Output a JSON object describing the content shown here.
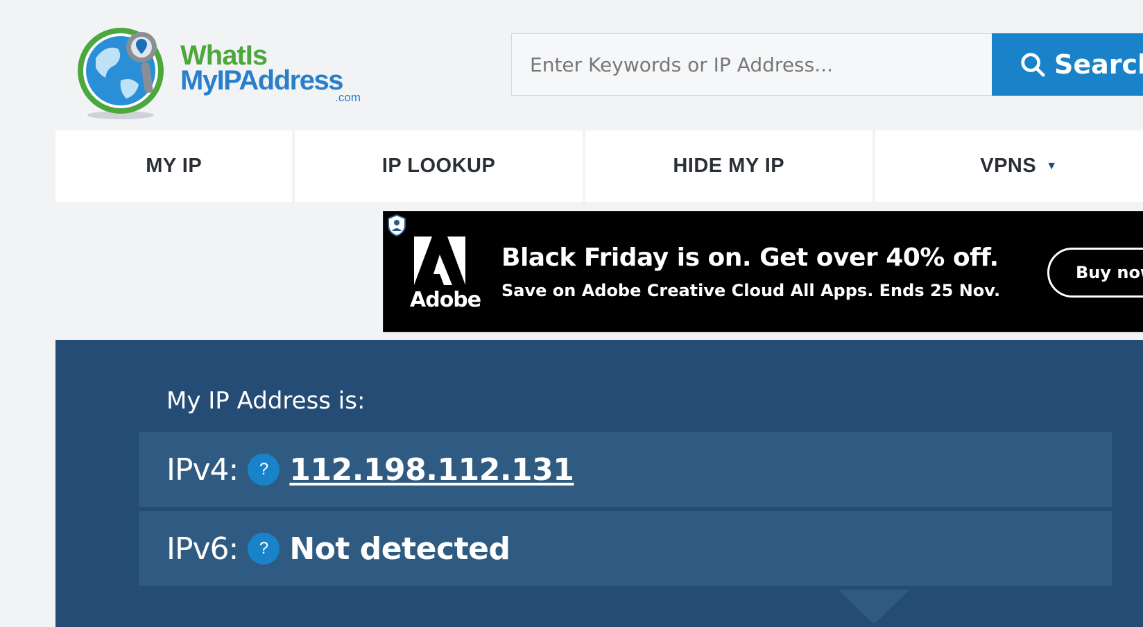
{
  "brand": {
    "line1": "WhatIs",
    "line2": "MyIPAddress",
    "suffix": ".com"
  },
  "search": {
    "placeholder": "Enter Keywords or IP Address...",
    "button_label": "Search",
    "button_icon": "search-icon"
  },
  "nav": {
    "items": [
      {
        "label": "MY IP"
      },
      {
        "label": "IP LOOKUP"
      },
      {
        "label": "HIDE MY IP"
      },
      {
        "label": "VPNS",
        "icon": "caret-down-icon"
      }
    ]
  },
  "ad": {
    "brand": "Adobe",
    "headline": "Black Friday is on. Get over 40% off.",
    "subline": "Save on Adobe Creative Cloud All Apps. Ends 25 Nov.",
    "cta": "Buy now"
  },
  "ip": {
    "heading": "My IP Address is:",
    "ipv4_label": "IPv4:",
    "ipv4_value": "112.198.112.131",
    "ipv6_label": "IPv6:",
    "ipv6_value": "Not detected",
    "help_glyph": "?"
  },
  "colors": {
    "accent": "#1a82c8",
    "panel": "#244c74",
    "panel_row": "#2f5b82",
    "logo_green": "#4ca73c",
    "logo_blue": "#2a7fcb"
  }
}
